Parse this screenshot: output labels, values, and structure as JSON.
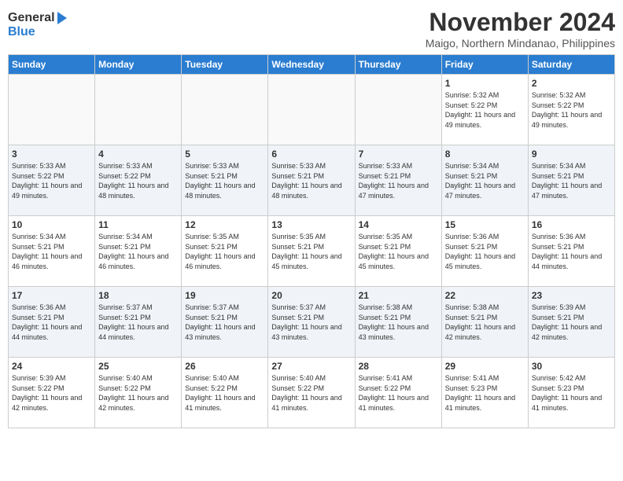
{
  "header": {
    "logo_line1": "General",
    "logo_line2": "Blue",
    "month_year": "November 2024",
    "location": "Maigo, Northern Mindanao, Philippines"
  },
  "weekdays": [
    "Sunday",
    "Monday",
    "Tuesday",
    "Wednesday",
    "Thursday",
    "Friday",
    "Saturday"
  ],
  "weeks": [
    [
      {
        "day": "",
        "info": ""
      },
      {
        "day": "",
        "info": ""
      },
      {
        "day": "",
        "info": ""
      },
      {
        "day": "",
        "info": ""
      },
      {
        "day": "",
        "info": ""
      },
      {
        "day": "1",
        "info": "Sunrise: 5:32 AM\nSunset: 5:22 PM\nDaylight: 11 hours and 49 minutes."
      },
      {
        "day": "2",
        "info": "Sunrise: 5:32 AM\nSunset: 5:22 PM\nDaylight: 11 hours and 49 minutes."
      }
    ],
    [
      {
        "day": "3",
        "info": "Sunrise: 5:33 AM\nSunset: 5:22 PM\nDaylight: 11 hours and 49 minutes."
      },
      {
        "day": "4",
        "info": "Sunrise: 5:33 AM\nSunset: 5:22 PM\nDaylight: 11 hours and 48 minutes."
      },
      {
        "day": "5",
        "info": "Sunrise: 5:33 AM\nSunset: 5:21 PM\nDaylight: 11 hours and 48 minutes."
      },
      {
        "day": "6",
        "info": "Sunrise: 5:33 AM\nSunset: 5:21 PM\nDaylight: 11 hours and 48 minutes."
      },
      {
        "day": "7",
        "info": "Sunrise: 5:33 AM\nSunset: 5:21 PM\nDaylight: 11 hours and 47 minutes."
      },
      {
        "day": "8",
        "info": "Sunrise: 5:34 AM\nSunset: 5:21 PM\nDaylight: 11 hours and 47 minutes."
      },
      {
        "day": "9",
        "info": "Sunrise: 5:34 AM\nSunset: 5:21 PM\nDaylight: 11 hours and 47 minutes."
      }
    ],
    [
      {
        "day": "10",
        "info": "Sunrise: 5:34 AM\nSunset: 5:21 PM\nDaylight: 11 hours and 46 minutes."
      },
      {
        "day": "11",
        "info": "Sunrise: 5:34 AM\nSunset: 5:21 PM\nDaylight: 11 hours and 46 minutes."
      },
      {
        "day": "12",
        "info": "Sunrise: 5:35 AM\nSunset: 5:21 PM\nDaylight: 11 hours and 46 minutes."
      },
      {
        "day": "13",
        "info": "Sunrise: 5:35 AM\nSunset: 5:21 PM\nDaylight: 11 hours and 45 minutes."
      },
      {
        "day": "14",
        "info": "Sunrise: 5:35 AM\nSunset: 5:21 PM\nDaylight: 11 hours and 45 minutes."
      },
      {
        "day": "15",
        "info": "Sunrise: 5:36 AM\nSunset: 5:21 PM\nDaylight: 11 hours and 45 minutes."
      },
      {
        "day": "16",
        "info": "Sunrise: 5:36 AM\nSunset: 5:21 PM\nDaylight: 11 hours and 44 minutes."
      }
    ],
    [
      {
        "day": "17",
        "info": "Sunrise: 5:36 AM\nSunset: 5:21 PM\nDaylight: 11 hours and 44 minutes."
      },
      {
        "day": "18",
        "info": "Sunrise: 5:37 AM\nSunset: 5:21 PM\nDaylight: 11 hours and 44 minutes."
      },
      {
        "day": "19",
        "info": "Sunrise: 5:37 AM\nSunset: 5:21 PM\nDaylight: 11 hours and 43 minutes."
      },
      {
        "day": "20",
        "info": "Sunrise: 5:37 AM\nSunset: 5:21 PM\nDaylight: 11 hours and 43 minutes."
      },
      {
        "day": "21",
        "info": "Sunrise: 5:38 AM\nSunset: 5:21 PM\nDaylight: 11 hours and 43 minutes."
      },
      {
        "day": "22",
        "info": "Sunrise: 5:38 AM\nSunset: 5:21 PM\nDaylight: 11 hours and 42 minutes."
      },
      {
        "day": "23",
        "info": "Sunrise: 5:39 AM\nSunset: 5:21 PM\nDaylight: 11 hours and 42 minutes."
      }
    ],
    [
      {
        "day": "24",
        "info": "Sunrise: 5:39 AM\nSunset: 5:22 PM\nDaylight: 11 hours and 42 minutes."
      },
      {
        "day": "25",
        "info": "Sunrise: 5:40 AM\nSunset: 5:22 PM\nDaylight: 11 hours and 42 minutes."
      },
      {
        "day": "26",
        "info": "Sunrise: 5:40 AM\nSunset: 5:22 PM\nDaylight: 11 hours and 41 minutes."
      },
      {
        "day": "27",
        "info": "Sunrise: 5:40 AM\nSunset: 5:22 PM\nDaylight: 11 hours and 41 minutes."
      },
      {
        "day": "28",
        "info": "Sunrise: 5:41 AM\nSunset: 5:22 PM\nDaylight: 11 hours and 41 minutes."
      },
      {
        "day": "29",
        "info": "Sunrise: 5:41 AM\nSunset: 5:23 PM\nDaylight: 11 hours and 41 minutes."
      },
      {
        "day": "30",
        "info": "Sunrise: 5:42 AM\nSunset: 5:23 PM\nDaylight: 11 hours and 41 minutes."
      }
    ]
  ]
}
